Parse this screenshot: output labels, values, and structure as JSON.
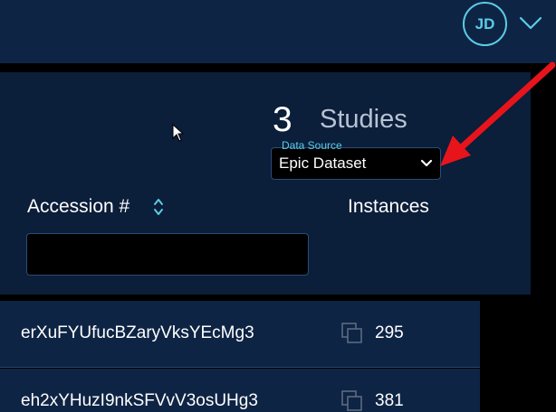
{
  "header": {
    "user_initials": "JD",
    "menu_icon": "chevron-down-icon"
  },
  "study_list": {
    "count": "3",
    "count_label": "Studies",
    "data_source": {
      "label": "Data Source",
      "value": "Epic Dataset"
    },
    "columns": {
      "accession": "Accession #",
      "instances": "Instances"
    },
    "filters": {
      "accession": ""
    },
    "rows": [
      {
        "accession": "erXuFYUfucBZaryVksYEcMg3",
        "instances": "295"
      },
      {
        "accession": "eh2xYHuzI9nkSFVvV3osUHg3",
        "instances": "381"
      }
    ]
  },
  "colors": {
    "header_bg": "#0e2444",
    "panel_bg": "#0b1e3a",
    "accent": "#5acce6",
    "annotation_arrow": "#e8141c"
  }
}
